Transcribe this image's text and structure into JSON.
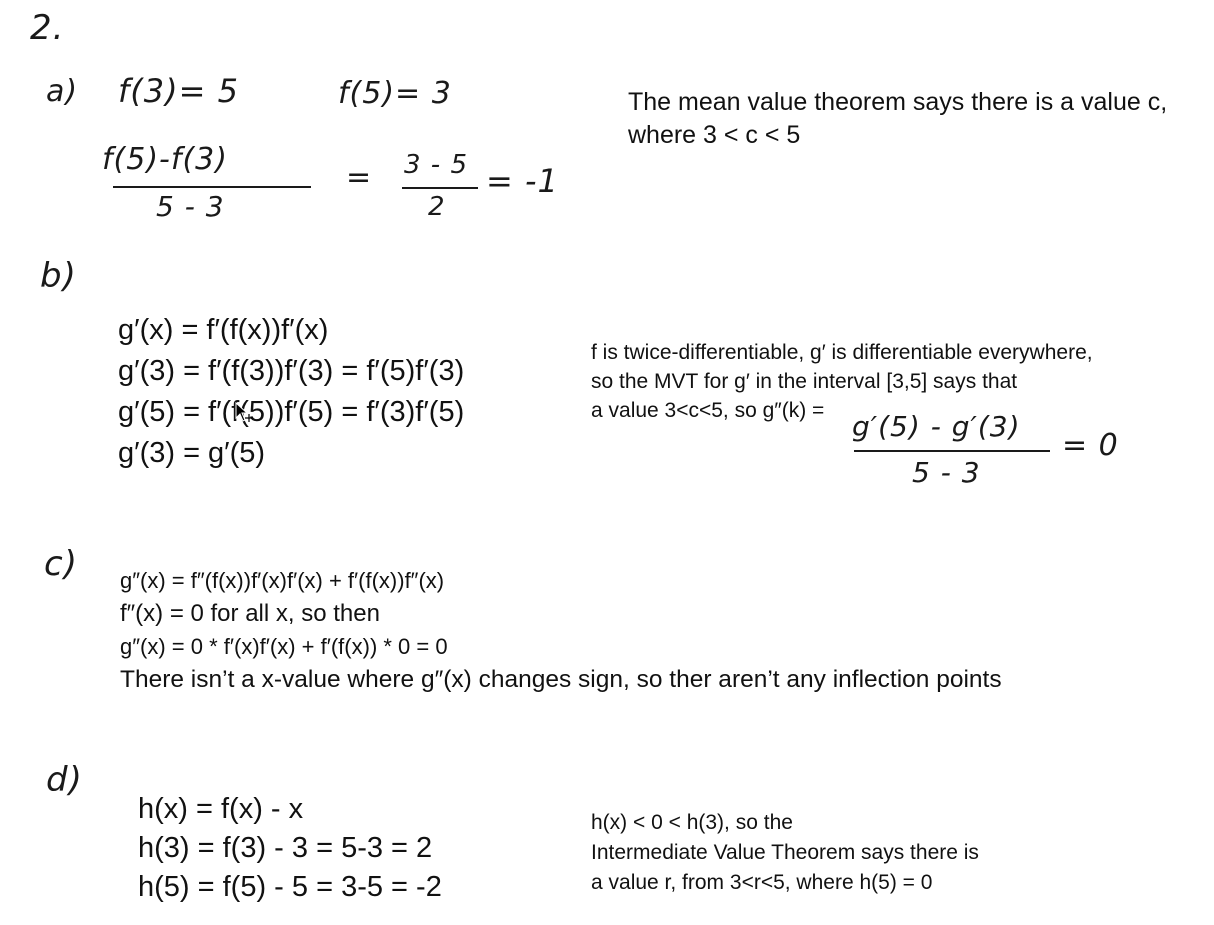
{
  "problem_number": "2.",
  "part_a": {
    "label": "a)",
    "given_1": "f(3)= 5",
    "given_2": "f(5)= 3",
    "frac_num": "f(5)-f(3)",
    "frac_den": "5 - 3",
    "eq_1": "=",
    "frac2_num": "3 - 5",
    "frac2_den": "2",
    "result": "= -1",
    "note_line1": "The mean value theorem says there is a value c,",
    "note_line2": "where 3 < c < 5"
  },
  "part_b": {
    "label": "b)",
    "lines": [
      "g′(x) = f′(f(x))f′(x)",
      "g′(3) = f′(f(3))f′(3) = f′(5)f′(3)",
      "g′(5) = f′(f(5))f′(5) = f′(3)f′(5)",
      "g′(3) = g′(5)"
    ],
    "note_line1": "f is twice-differentiable, g′ is differentiable everywhere,",
    "note_line2": "so the MVT for g′ in the interval [3,5] says that",
    "note_line3": "a value 3<c<5, so g″(k) =",
    "frac_num": "g′(5) - g′(3)",
    "frac_den": "5 - 3",
    "result": "= 0"
  },
  "part_c": {
    "label": "c)",
    "line1": "g″(x) = f″(f(x))f′(x)f′(x) + f′(f(x))f″(x)",
    "line2": "f″(x) = 0 for all x, so then",
    "line3": "g″(x) = 0 * f′(x)f′(x) + f′(f(x)) * 0 = 0",
    "line4": "There isn’t a x-value where g″(x) changes sign, so ther aren’t any inflection points"
  },
  "part_d": {
    "label": "d)",
    "lines": [
      "h(x) = f(x) - x",
      "h(3) = f(3) - 3 = 5-3 = 2",
      "h(5) = f(5) - 5 = 3-5 = -2"
    ],
    "note_line1": "h(x) < 0 < h(3), so the",
    "note_line2": "Intermediate Value Theorem says there is",
    "note_line3": "a value r, from 3<r<5, where h(5) = 0"
  }
}
